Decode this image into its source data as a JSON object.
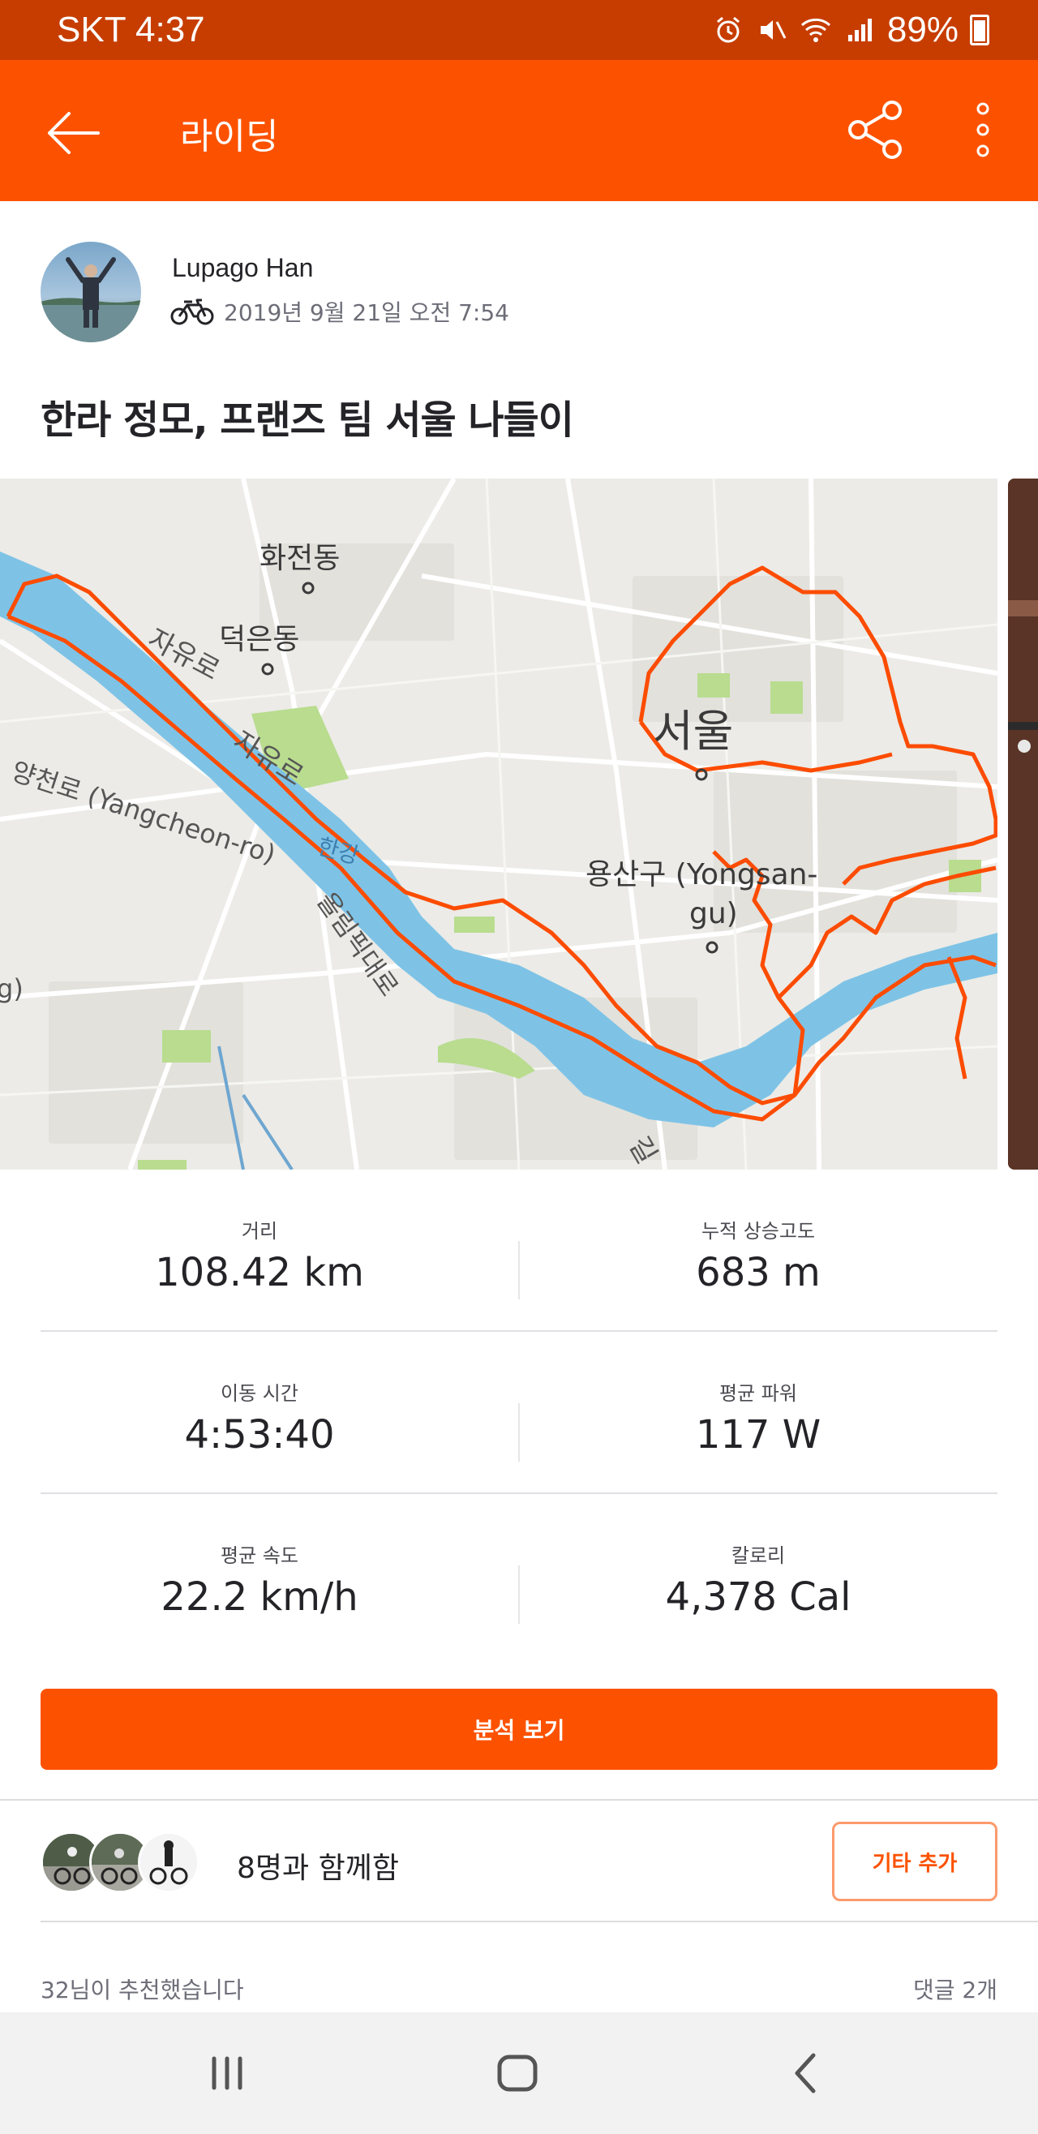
{
  "status_bar": {
    "carrier_time": "SKT 4:37",
    "battery": "89%",
    "icons": [
      "alarm-icon",
      "mute-icon",
      "wifi-icon",
      "signal-icon",
      "battery-icon"
    ]
  },
  "app_bar": {
    "title": "라이딩",
    "icons": [
      "back-arrow-icon",
      "share-icon",
      "more-vertical-icon"
    ]
  },
  "athlete": {
    "name": "Lupago Han",
    "date": "2019년 9월 21일 오전 7:54",
    "activity_icon": "bicycle-icon"
  },
  "activity": {
    "title": "한라 정모, 프랜즈 팀 서울 나들이"
  },
  "map": {
    "labels": {
      "hwajeon": "화전동",
      "deogeun": "덕은동",
      "jayuro1": "자유로",
      "jayuro2": "자유로",
      "yangcheon": "양천로 (Yangcheon-ro)",
      "hangang": "한강",
      "olympic": "올림픽대로",
      "seoul": "서울",
      "yongsan_1": "용산구 (Yongsan-",
      "yongsan_2": "gu)",
      "gil": "길",
      "edge_g": "g)"
    },
    "colors": {
      "route": "#fc4c02",
      "river": "#7ec3e6",
      "land": "#ecebe7",
      "park": "#b9dc8f"
    }
  },
  "stats": [
    {
      "left": {
        "label": "거리",
        "value": "108.42 km"
      },
      "right": {
        "label": "누적 상승고도",
        "value": "683 m"
      }
    },
    {
      "left": {
        "label": "이동 시간",
        "value": "4:53:40"
      },
      "right": {
        "label": "평균 파워",
        "value": "117 W"
      }
    },
    {
      "left": {
        "label": "평균 속도",
        "value": "22.2 km/h"
      },
      "right": {
        "label": "칼로리",
        "value": "4,378 Cal"
      }
    }
  ],
  "analysis_button": "분석 보기",
  "group": {
    "text": "8명과 함께함",
    "add_button": "기타 추가"
  },
  "social": {
    "kudos": "32님이 추천했습니다",
    "comments": "댓글 2개"
  },
  "nav_bar": {
    "icons": [
      "recents-icon",
      "home-icon",
      "back-icon"
    ]
  },
  "colors": {
    "brand": "#fc5200",
    "status_bar": "#c73d00"
  }
}
